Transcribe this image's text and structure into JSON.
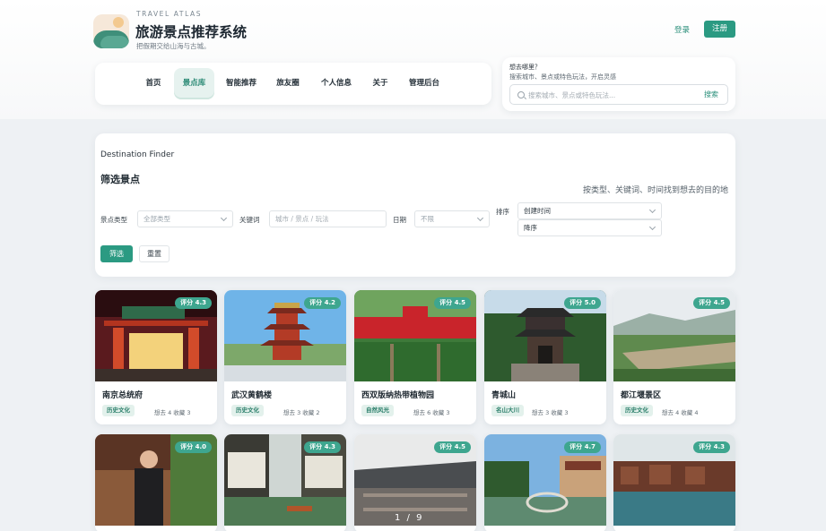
{
  "brand": {
    "tag": "TRAVEL ATLAS",
    "title": "旅游景点推荐系统",
    "subtitle": "把假期交给山海与古城。"
  },
  "auth": {
    "login": "登录",
    "register": "注册"
  },
  "nav": {
    "items": [
      {
        "label": "首页"
      },
      {
        "label": "景点库",
        "active": true
      },
      {
        "label": "智能推荐"
      },
      {
        "label": "旅友圈"
      },
      {
        "label": "个人信息"
      },
      {
        "label": "关于"
      },
      {
        "label": "管理后台"
      }
    ]
  },
  "search": {
    "title": "想去哪里？",
    "subtitle": "搜索城市、景点或特色玩法，开启灵感",
    "placeholder": "搜索城市、景点或特色玩法...",
    "button": "搜索"
  },
  "filter": {
    "eyebrow": "Destination Finder",
    "title": "筛选景点",
    "description": "按类型、关键词、时间找到想去的目的地",
    "type_label": "景点类型",
    "type_value": "全部类型",
    "keyword_label": "关键词",
    "keyword_placeholder": "城市 / 景点 / 玩法",
    "date_label": "日期",
    "date_value": "不限",
    "sort_label": "排序",
    "sort_value": "创建时间",
    "order_value": "降序",
    "apply_button": "筛选",
    "reset_button": "重置"
  },
  "spots": [
    {
      "name": "南京总统府",
      "rating": "评分 4.3",
      "tag": "历史文化",
      "stats": "想去 4  收藏 3"
    },
    {
      "name": "武汉黄鹤楼",
      "rating": "评分 4.2",
      "tag": "历史文化",
      "stats": "想去 3  收藏 2"
    },
    {
      "name": "西双版纳热带植物园",
      "rating": "评分 4.5",
      "tag": "自然风光",
      "stats": "想去 6  收藏 3"
    },
    {
      "name": "青城山",
      "rating": "评分 5.0",
      "tag": "名山大川",
      "stats": "想去 3  收藏 3"
    },
    {
      "name": "都江堰景区",
      "rating": "评分 4.5",
      "tag": "历史文化",
      "stats": "想去 4  收藏 4"
    },
    {
      "name": "",
      "rating": "评分 4.0",
      "tag": "",
      "stats": ""
    },
    {
      "name": "",
      "rating": "评分 4.3",
      "tag": "",
      "stats": ""
    },
    {
      "name": "",
      "rating": "评分 4.5",
      "tag": "",
      "stats": ""
    },
    {
      "name": "",
      "rating": "评分 4.7",
      "tag": "",
      "stats": ""
    },
    {
      "name": "",
      "rating": "评分 4.3",
      "tag": "",
      "stats": ""
    }
  ],
  "pager": "1 / 9"
}
